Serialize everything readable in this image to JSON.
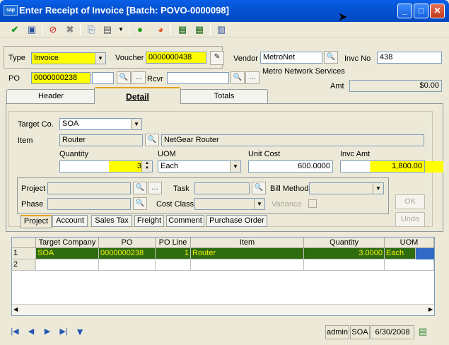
{
  "window": {
    "title": "Enter Receipt of Invoice [Batch: POVO-0000098]",
    "logo": "sap"
  },
  "toolbar": {
    "icons": [
      "check-icon",
      "save-icon",
      "cancel-circle-icon",
      "delete-x-icon",
      "copy-icon",
      "print-icon",
      "dropdown-arrow-icon",
      "help-icon",
      "chart-icon",
      "grid-export-icon",
      "grid-import-icon",
      "calculator-icon"
    ]
  },
  "header": {
    "type_label": "Type",
    "type_value": "Invoice",
    "voucher_label": "Voucher",
    "voucher_value": "0000000438",
    "vendor_label": "Vendor",
    "vendor_value": "MetroNet",
    "invcno_label": "Invc No",
    "invcno_value": "438",
    "po_label": "PO",
    "po_value": "0000000238",
    "rcvr_label": "Rcvr",
    "rcvr_value": "",
    "vendor_name": "Metro Network Services",
    "amt_label": "Amt",
    "amt_value": "$0.00"
  },
  "tabs": [
    {
      "label": "Header"
    },
    {
      "label": "Detail"
    },
    {
      "label": "Totals"
    }
  ],
  "detail": {
    "targetco_label": "Target Co.",
    "targetco_value": "SOA",
    "item_label": "Item",
    "item_value": "Router",
    "item_desc": "NetGear Router",
    "qty_label": "Quantity",
    "qty_value": "3",
    "uom_label": "UOM",
    "uom_value": "Each",
    "unitcost_label": "Unit Cost",
    "unitcost_value": "600.0000",
    "invcamt_label": "Invc Amt",
    "invcamt_value": "1,800.00",
    "project_label": "Project",
    "task_label": "Task",
    "billmethod_label": "Bill Method",
    "phase_label": "Phase",
    "costclass_label": "Cost Class",
    "variance_label": "Variance",
    "ok_label": "OK",
    "undo_label": "Undo",
    "subtabs": [
      "Project",
      "Account",
      "Sales Tax",
      "Freight",
      "Comment",
      "Purchase Order"
    ]
  },
  "grid": {
    "columns": [
      "Target Company",
      "PO",
      "PO Line",
      "Item",
      "Quantity",
      "UOM"
    ],
    "rows": [
      {
        "num": "1",
        "target": "SOA",
        "po": "0000000238",
        "poline": "1",
        "item": "Router",
        "qty": "3.0000",
        "uom": "Each"
      },
      {
        "num": "2",
        "target": "",
        "po": "",
        "poline": "",
        "item": "",
        "qty": "",
        "uom": ""
      }
    ]
  },
  "status": {
    "user": "admin",
    "company": "SOA",
    "date": "6/30/2008"
  },
  "colors": {
    "title_bar": "#0453D2",
    "highlight": "#FFFF00",
    "selected_row": "#2F6B0F",
    "selected_text": "#F3F30A"
  }
}
